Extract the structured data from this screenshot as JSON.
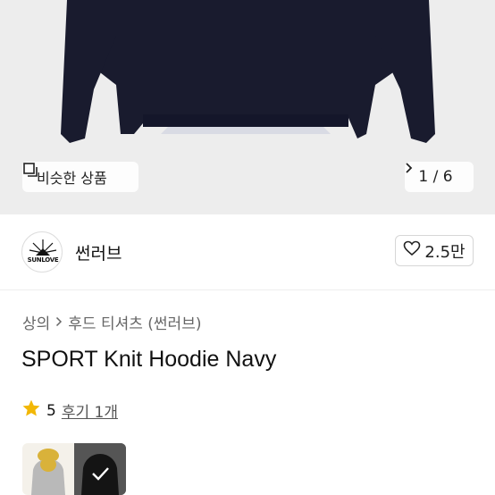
{
  "hero": {
    "similar_label": "비슷한 상품",
    "counter": "1 / 6",
    "colors": {
      "background": "#ededed",
      "garment": "#191b2e"
    }
  },
  "brand": {
    "logo_text": "SUNLOVE",
    "name": "썬러브",
    "likes": "2.5만"
  },
  "breadcrumb": {
    "category": "상의",
    "subcategory": "후드 티셔츠 (썬러브)"
  },
  "product": {
    "title": "SPORT Knit Hoodie Navy",
    "rating": "5",
    "reviews": "후기 1개"
  },
  "colors": {
    "star": "#f2b705"
  }
}
